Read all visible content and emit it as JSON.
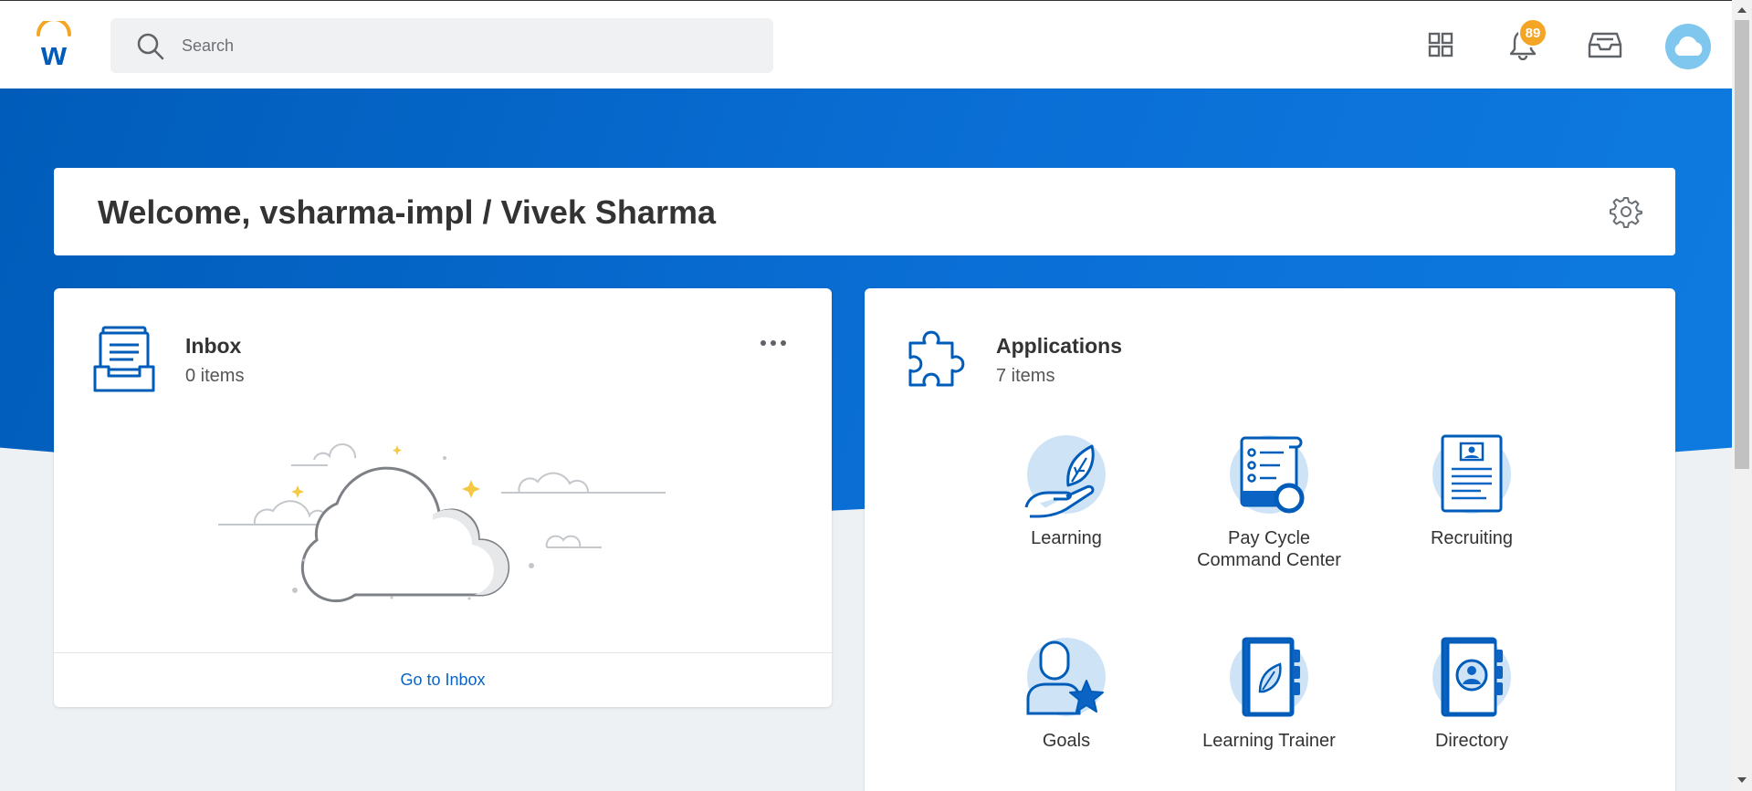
{
  "header": {
    "search_placeholder": "Search",
    "notification_count": "89",
    "icons": [
      "workday-logo-icon",
      "search-icon",
      "apps-grid-icon",
      "bell-icon",
      "inbox-tray-icon",
      "cloud-avatar-icon"
    ]
  },
  "welcome": {
    "title": "Welcome, vsharma-impl / Vivek Sharma"
  },
  "inbox": {
    "title": "Inbox",
    "subtitle": "0 items",
    "link": "Go to Inbox"
  },
  "applications": {
    "title": "Applications",
    "subtitle": "7 items",
    "items": [
      {
        "label": "Learning",
        "icon": "learning-icon"
      },
      {
        "label": "Pay Cycle Command Center",
        "line1": "Pay Cycle",
        "line2": "Command Center",
        "icon": "pay-cycle-icon"
      },
      {
        "label": "Recruiting",
        "icon": "recruiting-icon"
      },
      {
        "label": "Goals",
        "icon": "goals-icon"
      },
      {
        "label": "Learning Trainer",
        "icon": "learning-trainer-icon"
      },
      {
        "label": "Directory",
        "icon": "directory-icon"
      }
    ]
  },
  "colors": {
    "brand_blue": "#005cb9",
    "accent_orange": "#f5a524",
    "link_blue": "#0b64c3",
    "page_bg": "#eef1f4"
  }
}
